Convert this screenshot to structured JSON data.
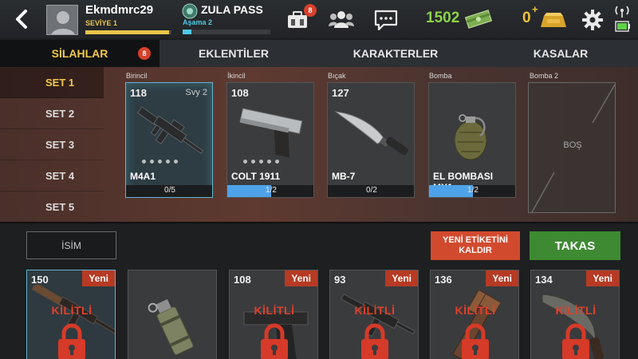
{
  "header": {
    "username": "Ekmdmrc29",
    "level_label": "SEVİYE 1",
    "xp_fraction": 0.97,
    "pass_title": "ZULA PASS",
    "pass_stage": "Aşama 2",
    "pass_fraction": 0.1,
    "briefcase_badge": "8",
    "money": "1502",
    "gold": "0",
    "gold_plus": "+",
    "icons": [
      "back-arrow-icon",
      "briefcase-icon",
      "friends-icon",
      "chat-icon",
      "cash-icon",
      "gold-bar-icon",
      "gear-icon",
      "signal-icon",
      "battery-icon"
    ]
  },
  "tabs": [
    {
      "label": "SİLAHLAR",
      "badge": "8",
      "active": true
    },
    {
      "label": "EKLENTİLER"
    },
    {
      "label": "KARAKTERLER"
    },
    {
      "label": "KASALAR"
    }
  ],
  "sets": [
    "SET 1",
    "SET 2",
    "SET 3",
    "SET 4",
    "SET 5"
  ],
  "active_set": 0,
  "slots": [
    {
      "label": "Birincil",
      "number": "118",
      "level": "Svy 2",
      "name": "M4A1",
      "progress_text": "0/5",
      "progress": 0.0,
      "selected": true,
      "dots": 5
    },
    {
      "label": "İkincil",
      "number": "108",
      "level": "",
      "name": "COLT 1911",
      "progress_text": "1/2",
      "progress": 0.5,
      "dots": 5
    },
    {
      "label": "Bıçak",
      "number": "127",
      "level": "",
      "name": "MB-7",
      "progress_text": "0/2",
      "progress": 0.0,
      "dots": 0
    },
    {
      "label": "Bomba",
      "number": "",
      "level": "",
      "name": "EL BOMBASI MX1",
      "progress_text": "1/2",
      "progress": 0.5,
      "dots": 0
    },
    {
      "label": "Bomba 2",
      "empty_text": "BOŞ"
    }
  ],
  "bottom": {
    "name_button": "İSİM",
    "remove_new_button": "YENİ ETİKETİNİ\nKALDIR",
    "trade_button": "TAKAS"
  },
  "inventory": [
    {
      "number": "150",
      "new_label": "Yeni",
      "locked_label": "KİLİTLİ",
      "selected": true,
      "art": "rifle"
    },
    {
      "number": "",
      "new_label": "",
      "locked_label": "",
      "art": "smoke-grenade"
    },
    {
      "number": "108",
      "new_label": "Yeni",
      "locked_label": "KİLİTLİ",
      "art": "pistol"
    },
    {
      "number": "93",
      "new_label": "Yeni",
      "locked_label": "KİLİTLİ",
      "art": "smg"
    },
    {
      "number": "136",
      "new_label": "Yeni",
      "locked_label": "KİLİTLİ",
      "art": "wrench"
    },
    {
      "number": "134",
      "new_label": "Yeni",
      "locked_label": "KİLİTLİ",
      "art": "kukri"
    }
  ]
}
